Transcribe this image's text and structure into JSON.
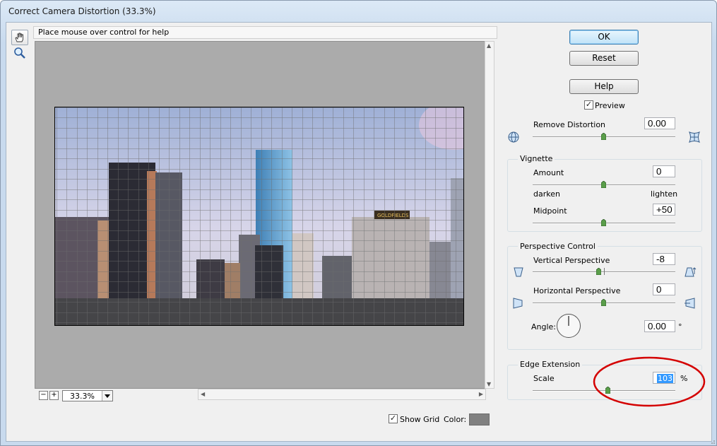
{
  "window": {
    "title": "Correct Camera Distortion (33.3%)"
  },
  "hint": {
    "text": "Place mouse over control for help"
  },
  "zoom": {
    "level": "33.3%"
  },
  "buttons": {
    "ok": "OK",
    "reset": "Reset",
    "help": "Help"
  },
  "preview": {
    "label": "Preview",
    "checked": true
  },
  "remove_distortion": {
    "label": "Remove Distortion",
    "value": "0.00"
  },
  "vignette": {
    "title": "Vignette",
    "amount_label": "Amount",
    "amount_value": "0",
    "darken": "darken",
    "lighten": "lighten",
    "midpoint_label": "Midpoint",
    "midpoint_value": "+50"
  },
  "perspective": {
    "title": "Perspective Control",
    "vertical_label": "Vertical Perspective",
    "vertical_value": "-8",
    "horizontal_label": "Horizontal Perspective",
    "horizontal_value": "0",
    "angle_label": "Angle:",
    "angle_value": "0.00",
    "angle_unit": "°"
  },
  "edge_extension": {
    "title": "Edge Extension",
    "scale_label": "Scale",
    "scale_value": "103",
    "unit": "%"
  },
  "grid": {
    "show_label": "Show Grid",
    "checked": true,
    "color_label": "Color:",
    "color": "#808080"
  },
  "annotation_color": "#d40000",
  "icons": [
    "hand-icon",
    "zoom-icon",
    "pincushion-icon",
    "barrel-icon",
    "vertical-perspective-top-icon",
    "vertical-perspective-bottom-icon",
    "horizontal-perspective-left-icon",
    "horizontal-perspective-right-icon"
  ]
}
